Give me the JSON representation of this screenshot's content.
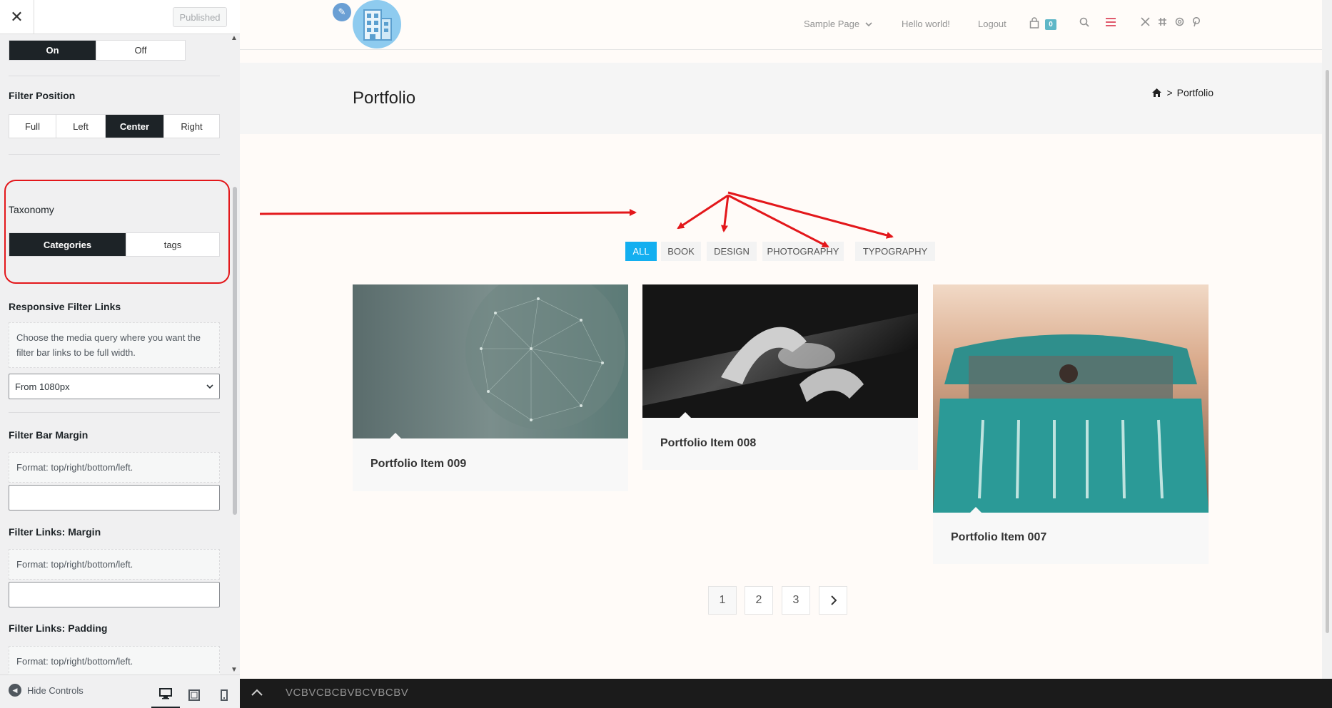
{
  "panel": {
    "close_glyph": "✕",
    "publish_label": "Published",
    "toggle": {
      "on": "On",
      "off": "Off"
    },
    "filter_position": {
      "label": "Filter Position",
      "options": [
        "Full",
        "Left",
        "Center",
        "Right"
      ],
      "selected": "Center"
    },
    "taxonomy": {
      "label": "Taxonomy",
      "options": [
        "Categories",
        "tags"
      ],
      "selected": "Categories"
    },
    "responsive_filter_links": {
      "label": "Responsive Filter Links",
      "description": "Choose the media query where you want the filter bar links to be full width.",
      "selected": "From 1080px"
    },
    "filter_bar_margin": {
      "label": "Filter Bar Margin",
      "description": "Format: top/right/bottom/left."
    },
    "filter_links_margin": {
      "label": "Filter Links: Margin",
      "description": "Format: top/right/bottom/left."
    },
    "filter_links_padding": {
      "label": "Filter Links: Padding",
      "description": "Format: top/right/bottom/left."
    },
    "footer": {
      "hide_controls": "Hide Controls"
    }
  },
  "site": {
    "nav": {
      "sample_page": "Sample Page",
      "hello_world": "Hello world!",
      "logout": "Logout",
      "cart_count": "0"
    },
    "page_title": "Portfolio",
    "breadcrumb_sep": ">",
    "breadcrumb_current": "Portfolio",
    "filters": [
      "ALL",
      "BOOK",
      "DESIGN",
      "PHOTOGRAPHY",
      "TYPOGRAPHY"
    ],
    "active_filter": "ALL",
    "items": [
      {
        "title": "Portfolio Item 009"
      },
      {
        "title": "Portfolio Item 008"
      },
      {
        "title": "Portfolio Item 007"
      }
    ],
    "pagination": [
      "1",
      "2",
      "3"
    ],
    "current_page": "1",
    "bottom_bar_text": "VCBVCBCBVBCVBCBV"
  },
  "colors": {
    "accent": "#13aff0",
    "panel_dark": "#1d2327",
    "annotation": "#e3171b"
  }
}
